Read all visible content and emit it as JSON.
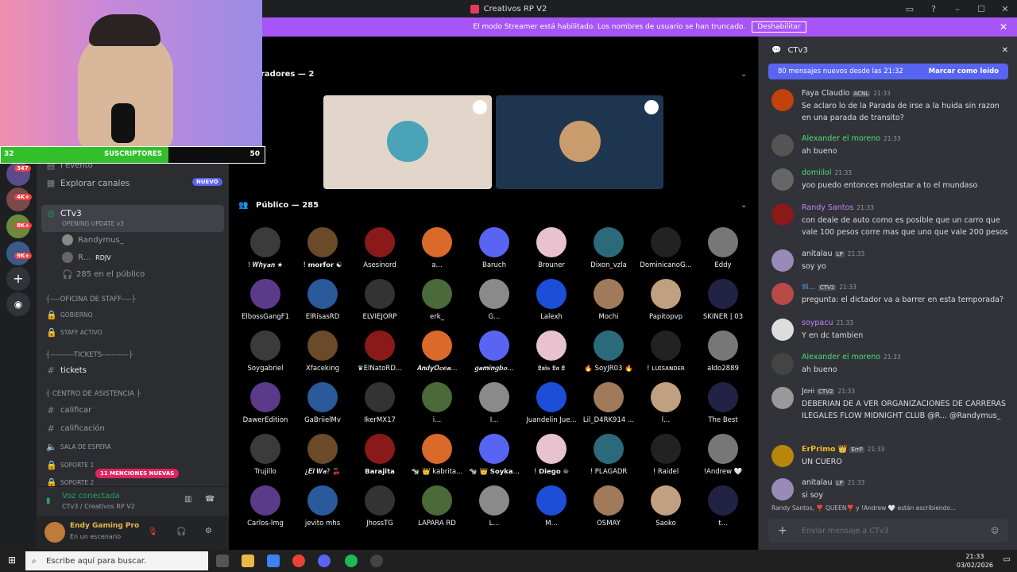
{
  "window": {
    "title": "Creativos RP V2"
  },
  "streamer_banner": {
    "text": "El modo Streamer está habilitado. Los nombres de usuario se han truncado.",
    "button": "Deshabilitar"
  },
  "overlay": {
    "subs_current": "32",
    "subs_label": "SUSCRIPTORES",
    "subs_goal": "50",
    "subs_progress": 0.64
  },
  "servers": {
    "badges": [
      "347",
      "4K+",
      "8K+",
      "9K+"
    ]
  },
  "sidebar": {
    "evento": "I evento",
    "explorar": "Explorar canales",
    "nuevo": "NUEVO",
    "stage_channel": "CTv3",
    "stage_sub": "OPENING UPDATE v3",
    "speakers": [
      "Randymus_",
      "R...",
      "RDJV"
    ],
    "audience": "285 en el público",
    "cat1": "┤----OFICINA DE STAFF----├",
    "gobierno": "GOBIERNO",
    "staff": "STAFF ACTIVO",
    "cat2": "┤----------TICKETS-----------├",
    "tickets": "tickets",
    "cat3": "┤ CENTRO DE ASISTENCIA ├",
    "calificar": "calificar",
    "calificacion": "calificación",
    "sala": "SALA DE ESPERA",
    "soporte1": "SOPORTE 1",
    "soporte2": "SOPORTE 2",
    "menciones": "11 MENCIONES NUEVAS",
    "voice_status": "Voz conectada",
    "voice_sub": "CTv3 / Creativos RP V2",
    "user_name": "Endy Gaming Pro",
    "user_status": "En un escenario"
  },
  "stage": {
    "speakers_header": "radores — 2",
    "audience_header": "Público — 285",
    "audience": [
      "! 𝑾𝒉𝒚𝒂𝒏 ★",
      "! 𝗺𝗼𝗿𝗳𝗼𝗿 ☯",
      "Asesinord",
      "a...",
      "Baruch",
      "Brouner",
      "Dixon_vzla",
      "DominicanoG...",
      "Eddy",
      "ElbossGangF1",
      "ElRisasRD",
      "ELVIEJORP",
      "erk_",
      "G...",
      "Lalexh",
      "Mochi",
      "Papitopvp",
      "SKINER | 03",
      "Soygabriel",
      "Xfaceking",
      "♛ElNatoRD...",
      "𝑨𝒏𝒅𝒚𝑶𝒄𝒆𝒂...",
      "𝒈𝒂𝒎𝒊𝒏𝒈𝒃𝒐...",
      "𝕷𝖚𝖎𝖘 𝕷𝖆 𝕷",
      "🔥 SoyJR03 🔥",
      "! ʟᴜɪsᴀɴᴅᴇʀ",
      "aldo2889",
      "DawerEdition",
      "GaBriielMv",
      "IkerMX17",
      "i...",
      "I...",
      "Juandelin Jue...",
      "Lil_D4RK914 ...",
      "l...",
      "The Best",
      "Trujillo",
      "¿𝑬𝒍 𝑾𝒂? 🍒",
      "𝗕𝗮𝗿𝗮𝗷𝗶𝘁𝗮",
      "🐄 👑 kabrita...",
      "🐄 👑 𝗦𝗼𝘆𝗸𝗮...",
      "! 𝗗𝗶𝗲𝗴𝗼 ☠",
      "! PLAGADR",
      "! Raidel",
      "!Andrew 🤍",
      "Carlos-lmg",
      "jevito mhs",
      "JhossTG",
      "LAPARA RD",
      "L...",
      "M...",
      "OSMAY",
      "Saoko",
      "t..."
    ]
  },
  "chat": {
    "channel": "CTv3",
    "new_text": "80 mensajes nuevos desde las 21:32",
    "mark_read": "Marcar como leído",
    "messages": [
      {
        "user": "Faya Claudio",
        "tag": "ACNL",
        "time": "21:33",
        "text": "Se aclaro lo de la Parada de irse a la huida sin razon en una parada de transito?",
        "color": "#dbdee1"
      },
      {
        "user": "Alexander el moreno",
        "time": "21:33",
        "text": "ah bueno",
        "color": "#4ade80"
      },
      {
        "user": "domiilol",
        "time": "21:33",
        "text": "yoo puedo entonces molestar a  to el mundaso",
        "color": "#4ade80"
      },
      {
        "user": "Randy Santos",
        "time": "21:33",
        "text": "con deale de auto como es posible que un carro que vale 100 pesos corre mas que uno que vale 200 pesos",
        "color": "#c084fc"
      },
      {
        "user": "anitalau",
        "tag": "LP",
        "time": "21:33",
        "text": "soy yo",
        "color": "#dbdee1"
      },
      {
        "user": "𝔐...",
        "tag": "CTV2",
        "time": "21:33",
        "text": "pregunta: el dictador va a barrer en esta temporada?",
        "color": "#60a5fa"
      },
      {
        "user": "soypacu",
        "time": "21:33",
        "text": "Y en dc tambien",
        "color": "#c084fc"
      },
      {
        "user": "Alexander el moreno",
        "time": "21:33",
        "text": "ah bueno",
        "color": "#4ade80"
      },
      {
        "user": "J𝔞𝔳𝔦𝔦",
        "tag": "CTV2",
        "time": "21:33",
        "text": "DEBERIAN DE A VER ORGANIZACIONES  DE CARRERAS ILEGALES FLOW MIDNIGHT CLUB @R... @Randymus_",
        "color": "#dbdee1"
      },
      {
        "user": "𝗘𝗿𝗣𝗿𝗶𝗺𝗼 👑",
        "tag": "ErrP",
        "time": "21:33",
        "text": "UN CUERO",
        "color": "#fbbf24"
      },
      {
        "user": "anitalau",
        "tag": "LP",
        "time": "21:33",
        "text": "si soy",
        "color": "#dbdee1"
      }
    ],
    "typing": "Randy Santos, ❣️ QUEEN❣️ y !Andrew 🤍 están escribiendo...",
    "placeholder": "Enviar mensaje a CTv3"
  },
  "taskbar": {
    "search": "Escribe aquí para buscar.",
    "time": "21:33",
    "date": "03/02/2026"
  }
}
